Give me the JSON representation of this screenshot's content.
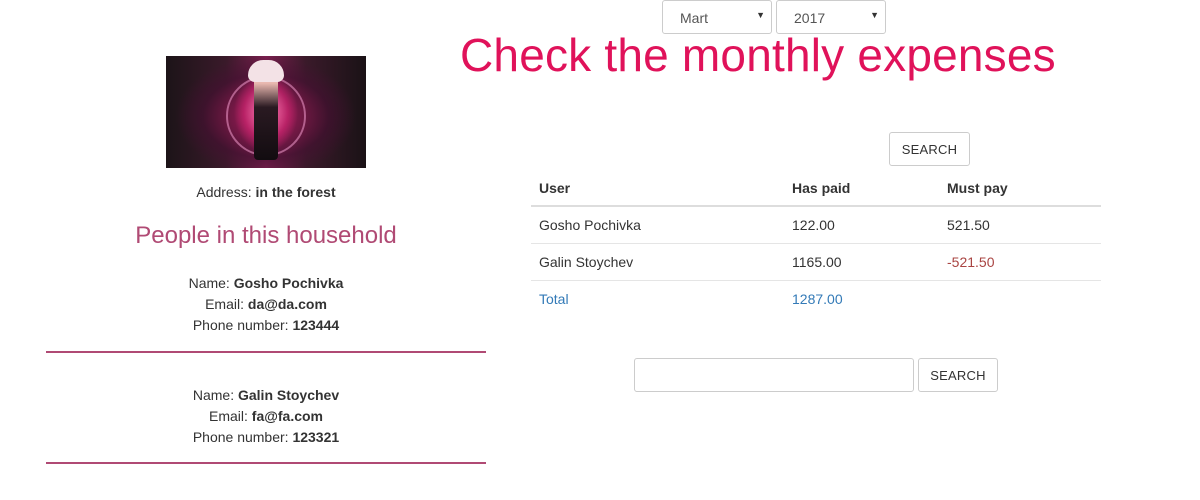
{
  "household": {
    "address_label": "Address:",
    "address_value": "in the forest",
    "people_title": "People in this household",
    "people": [
      {
        "name_label": "Name:",
        "name": "Gosho Pochivka",
        "email_label": "Email:",
        "email": "da@da.com",
        "phone_label": "Phone number:",
        "phone": "123444"
      },
      {
        "name_label": "Name:",
        "name": "Galin Stoychev",
        "email_label": "Email:",
        "email": "fa@fa.com",
        "phone_label": "Phone number:",
        "phone": "123321"
      }
    ]
  },
  "expenses": {
    "title": "Check the monthly expenses",
    "month_selected": "Mart",
    "year_selected": "2017",
    "search_label": "SEARCH",
    "columns": [
      "User",
      "Has paid",
      "Must pay"
    ],
    "rows": [
      {
        "user": "Gosho Pochivka",
        "has_paid": "122.00",
        "must_pay": "521.50"
      },
      {
        "user": "Galin Stoychev",
        "has_paid": "1165.00",
        "must_pay": "-521.50"
      }
    ],
    "total_label": "Total",
    "total_paid": "1287.00"
  },
  "search": {
    "value": "",
    "button_label": "SEARCH"
  },
  "colors": {
    "title": "#e0125a",
    "accent": "#b04a74",
    "link": "#337ab7",
    "negative": "#a94442"
  }
}
